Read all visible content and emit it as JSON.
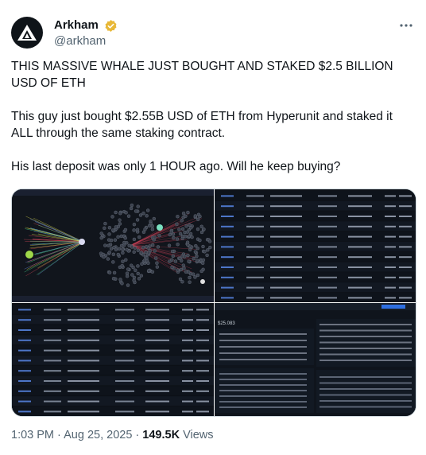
{
  "author": {
    "display_name": "Arkham",
    "handle": "@arkham",
    "avatar_icon": "arkham-logo-icon",
    "verified_icon": "verified-badge-icon",
    "verified_color": "#e8b838"
  },
  "tweet": {
    "text": "THIS MASSIVE WHALE JUST BOUGHT AND STAKED $2.5 BILLION USD OF ETH\n\nThis guy just bought $2.55B USD of ETH from Hyperunit and staked it ALL through the same staking contract.\n\nHis last deposit was only 1 HOUR ago. Will he keep buying?"
  },
  "media": {
    "panels": [
      {
        "label": "graph-view"
      },
      {
        "label": "transfers-table-top"
      },
      {
        "label": "transfers-table-bottom"
      },
      {
        "label": "entity-dashboard"
      }
    ],
    "dashboard_value": "$25.083"
  },
  "meta": {
    "time": "1:03 PM",
    "separator": "·",
    "date": "Aug 25, 2025",
    "views_count": "149.5K",
    "views_label": "Views"
  },
  "colors": {
    "text": "#0f1419",
    "secondary": "#536471",
    "dark_panel": "#0d1117"
  }
}
